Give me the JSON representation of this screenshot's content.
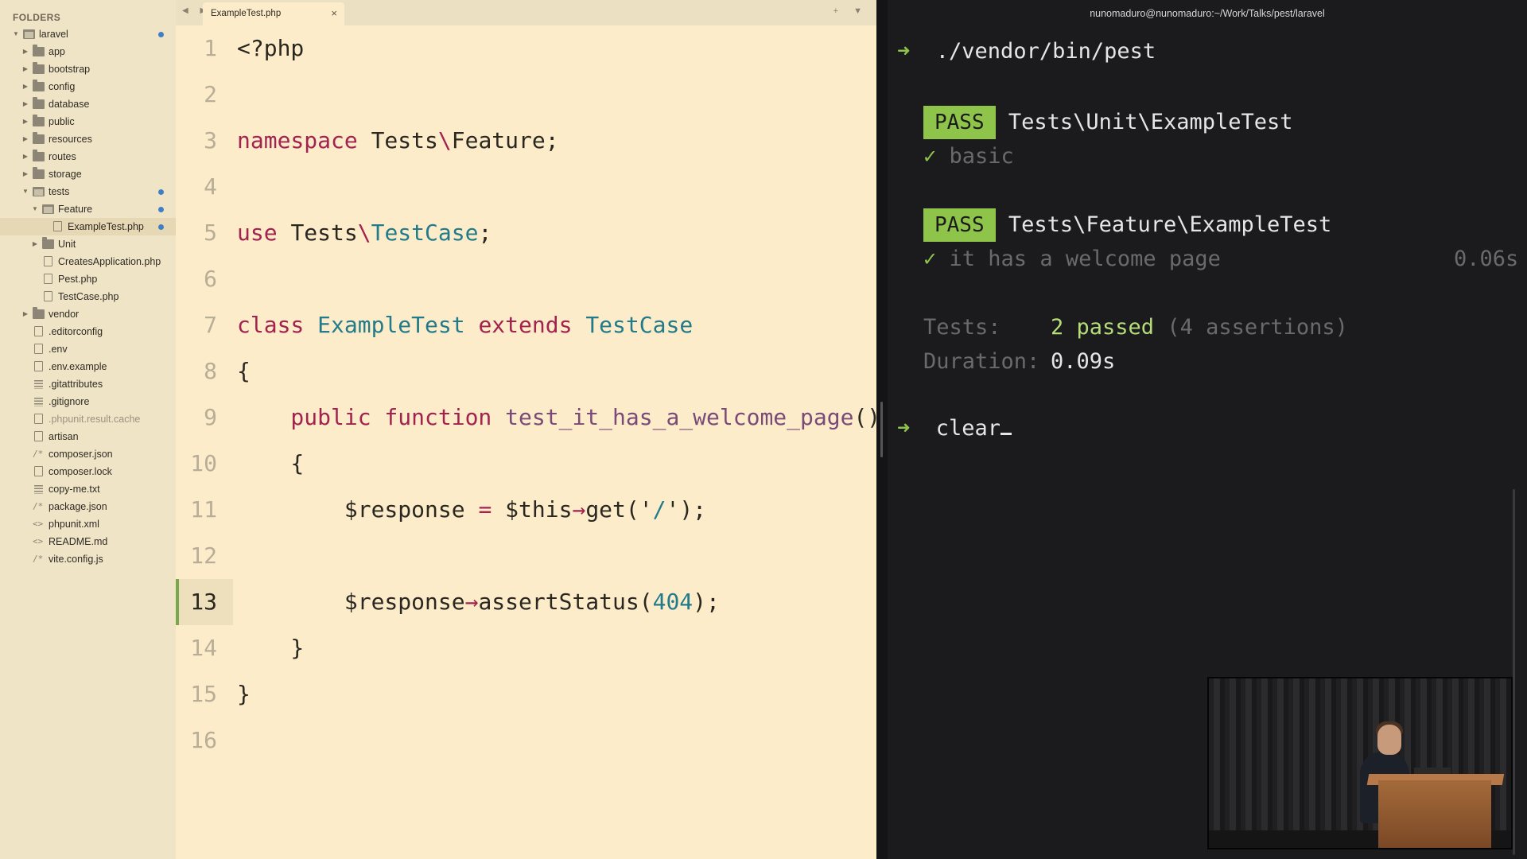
{
  "sidebar": {
    "header": "FOLDERS",
    "items": [
      {
        "label": "laravel",
        "type": "folder-open",
        "depth": 0,
        "arrow": "down",
        "modified": true
      },
      {
        "label": "app",
        "type": "folder",
        "depth": 1,
        "arrow": "right"
      },
      {
        "label": "bootstrap",
        "type": "folder",
        "depth": 1,
        "arrow": "right"
      },
      {
        "label": "config",
        "type": "folder",
        "depth": 1,
        "arrow": "right"
      },
      {
        "label": "database",
        "type": "folder",
        "depth": 1,
        "arrow": "right"
      },
      {
        "label": "public",
        "type": "folder",
        "depth": 1,
        "arrow": "right"
      },
      {
        "label": "resources",
        "type": "folder",
        "depth": 1,
        "arrow": "right"
      },
      {
        "label": "routes",
        "type": "folder",
        "depth": 1,
        "arrow": "right"
      },
      {
        "label": "storage",
        "type": "folder",
        "depth": 1,
        "arrow": "right"
      },
      {
        "label": "tests",
        "type": "folder-open",
        "depth": 1,
        "arrow": "down",
        "modified": true
      },
      {
        "label": "Feature",
        "type": "folder-open",
        "depth": 2,
        "arrow": "down",
        "modified": true
      },
      {
        "label": "ExampleTest.php",
        "type": "file",
        "depth": 3,
        "selected": true,
        "modified": true
      },
      {
        "label": "Unit",
        "type": "folder",
        "depth": 2,
        "arrow": "right"
      },
      {
        "label": "CreatesApplication.php",
        "type": "file",
        "depth": 2
      },
      {
        "label": "Pest.php",
        "type": "file",
        "depth": 2
      },
      {
        "label": "TestCase.php",
        "type": "file",
        "depth": 2
      },
      {
        "label": "vendor",
        "type": "folder",
        "depth": 1,
        "arrow": "right"
      },
      {
        "label": ".editorconfig",
        "type": "file",
        "depth": 1
      },
      {
        "label": ".env",
        "type": "file",
        "depth": 1
      },
      {
        "label": ".env.example",
        "type": "file",
        "depth": 1
      },
      {
        "label": ".gitattributes",
        "type": "lines",
        "depth": 1
      },
      {
        "label": ".gitignore",
        "type": "lines",
        "depth": 1
      },
      {
        "label": ".phpunit.result.cache",
        "type": "file",
        "depth": 1,
        "dim": true
      },
      {
        "label": "artisan",
        "type": "file",
        "depth": 1
      },
      {
        "label": "composer.json",
        "type": "slash",
        "depth": 1
      },
      {
        "label": "composer.lock",
        "type": "file",
        "depth": 1
      },
      {
        "label": "copy-me.txt",
        "type": "lines",
        "depth": 1
      },
      {
        "label": "package.json",
        "type": "slash",
        "depth": 1
      },
      {
        "label": "phpunit.xml",
        "type": "code",
        "depth": 1
      },
      {
        "label": "README.md",
        "type": "code",
        "depth": 1
      },
      {
        "label": "vite.config.js",
        "type": "slash",
        "depth": 1
      }
    ]
  },
  "editor": {
    "tab_label": "ExampleTest.php",
    "tab_close": "×",
    "nav_arrows": "◀ ▶",
    "tab_actions": "+ ▼",
    "active_line": 13,
    "lines": [
      {
        "n": "1",
        "tokens": [
          {
            "t": "<?php",
            "c": ""
          }
        ]
      },
      {
        "n": "2",
        "tokens": []
      },
      {
        "n": "3",
        "tokens": [
          {
            "t": "namespace ",
            "c": "kw"
          },
          {
            "t": "Tests",
            "c": ""
          },
          {
            "t": "\\",
            "c": "bs"
          },
          {
            "t": "Feature;",
            "c": ""
          }
        ]
      },
      {
        "n": "4",
        "tokens": []
      },
      {
        "n": "5",
        "tokens": [
          {
            "t": "use ",
            "c": "kw"
          },
          {
            "t": "Tests",
            "c": ""
          },
          {
            "t": "\\",
            "c": "bs"
          },
          {
            "t": "TestCase",
            "c": "cls"
          },
          {
            "t": ";",
            "c": ""
          }
        ]
      },
      {
        "n": "6",
        "tokens": []
      },
      {
        "n": "7",
        "tokens": [
          {
            "t": "class ",
            "c": "kw"
          },
          {
            "t": "ExampleTest ",
            "c": "cls"
          },
          {
            "t": "extends ",
            "c": "kw"
          },
          {
            "t": "TestCase",
            "c": "cls"
          }
        ]
      },
      {
        "n": "8",
        "tokens": [
          {
            "t": "{",
            "c": ""
          }
        ]
      },
      {
        "n": "9",
        "tokens": [
          {
            "t": "    public function ",
            "c": "kw"
          },
          {
            "t": "test_it_has_a_welcome_page",
            "c": "fn"
          },
          {
            "t": "()",
            "c": ""
          }
        ]
      },
      {
        "n": "10",
        "tokens": [
          {
            "t": "    {",
            "c": ""
          }
        ]
      },
      {
        "n": "11",
        "tokens": [
          {
            "t": "        $response ",
            "c": ""
          },
          {
            "t": "= ",
            "c": "kw"
          },
          {
            "t": "$this",
            "c": ""
          },
          {
            "t": "→",
            "c": "kw"
          },
          {
            "t": "get('",
            "c": ""
          },
          {
            "t": "/",
            "c": "cls"
          },
          {
            "t": "');",
            "c": ""
          }
        ]
      },
      {
        "n": "12",
        "tokens": []
      },
      {
        "n": "13",
        "tokens": [
          {
            "t": "        $response",
            "c": ""
          },
          {
            "t": "→",
            "c": "kw"
          },
          {
            "t": "assertStatus(",
            "c": ""
          },
          {
            "t": "404",
            "c": "num"
          },
          {
            "t": ");",
            "c": ""
          }
        ]
      },
      {
        "n": "14",
        "tokens": [
          {
            "t": "    }",
            "c": ""
          }
        ]
      },
      {
        "n": "15",
        "tokens": [
          {
            "t": "}",
            "c": ""
          }
        ]
      },
      {
        "n": "16",
        "tokens": []
      }
    ]
  },
  "terminal": {
    "title": "nunomaduro@nunomaduro:~/Work/Talks/pest/laravel",
    "prompt_symbol": "➜",
    "command": "./vendor/bin/pest",
    "pass_label": "PASS",
    "check": "✓",
    "suite1_name": "Tests\\Unit\\ExampleTest",
    "suite1_test": "basic",
    "suite2_name": "Tests\\Feature\\ExampleTest",
    "suite2_test": "it has a welcome page",
    "suite2_time": "0.06s",
    "tests_label": "Tests:",
    "tests_value": "2 passed",
    "tests_assertions": "(4 assertions)",
    "duration_label": "Duration:",
    "duration_value": "0.09s",
    "next_command": "clear"
  },
  "colors": {
    "sidebar_bg": "#f0e4c7",
    "editor_bg": "#fcecca",
    "terminal_bg": "#1b1b1d",
    "keyword": "#a3224f",
    "class": "#227b8a",
    "function": "#7a4a78",
    "pass_green": "#8ec44a",
    "active_line_marker": "#7aa64d",
    "modified_dot": "#3d7fc9"
  }
}
